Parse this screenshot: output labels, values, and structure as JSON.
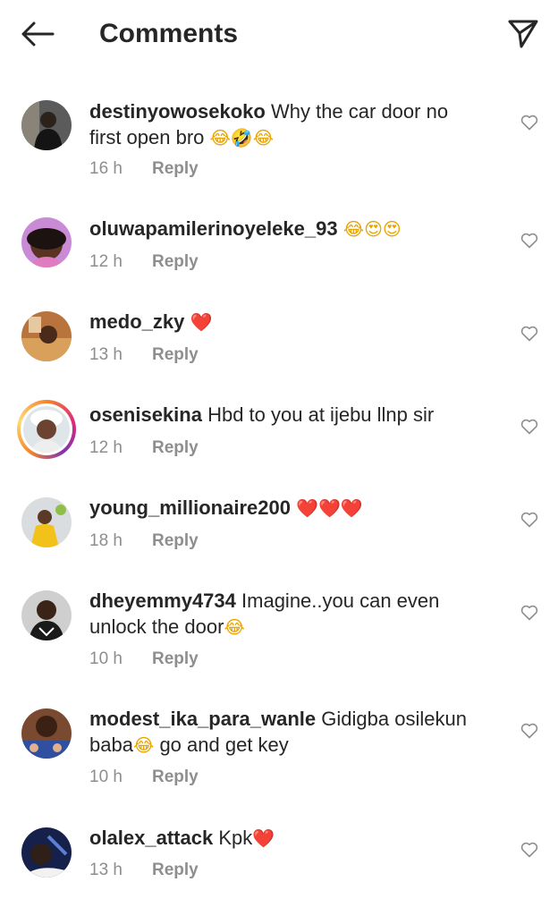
{
  "header": {
    "title": "Comments",
    "back_icon": "arrow-left-icon",
    "share_icon": "paper-plane-icon"
  },
  "reply_label": "Reply",
  "comments": [
    {
      "username": "destinyowosekoko",
      "text": "Why the car door no",
      "text2": "first open bro",
      "emojis": "😂🤣😂",
      "time": "16 h"
    },
    {
      "username": "oluwapamilerinoyeleke_93",
      "text": "",
      "emojis": "😂😍😍",
      "time": "12 h"
    },
    {
      "username": "medo_zky",
      "text": "",
      "emojis": "❤️",
      "time": "13 h"
    },
    {
      "username": "osenisekina",
      "text": "Hbd to you at ijebu llnp sir",
      "emojis": "",
      "time": "12 h"
    },
    {
      "username": "young_millionaire200",
      "text": "",
      "emojis": "❤️❤️❤️",
      "time": "18 h"
    },
    {
      "username": "dheyemmy4734",
      "text": "Imagine..you can even",
      "text2": "unlock the door",
      "emojis": "😂",
      "time": "10 h"
    },
    {
      "username": "modest_ika_para_wanle",
      "text": "Gidigba osilekun",
      "text2": "baba",
      "emojis": "😂",
      "text3": " go and get key",
      "time": "10 h"
    },
    {
      "username": "olalex_attack",
      "text": "Kpk",
      "emojis": "❤️",
      "time": "13 h"
    }
  ]
}
